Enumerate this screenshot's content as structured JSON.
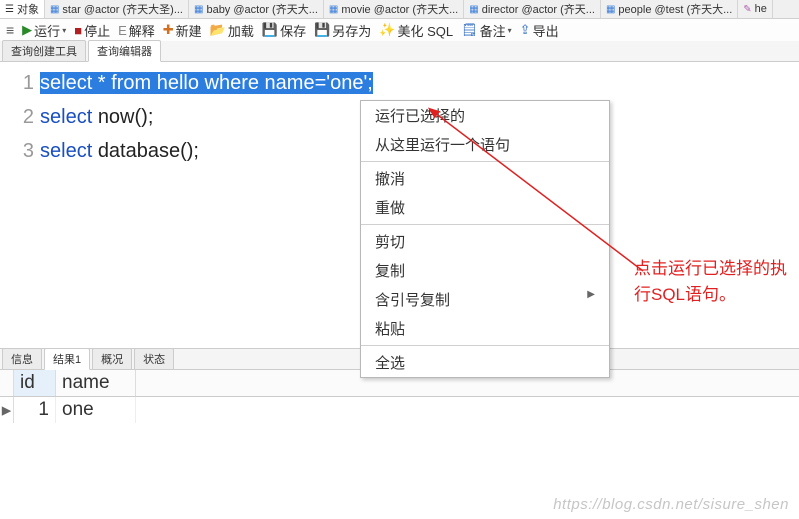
{
  "top_tabs": {
    "t0": "对象",
    "t1": "star @actor (齐天大圣)...",
    "t2": "baby @actor (齐天大...",
    "t3": "movie @actor (齐天大...",
    "t4": "director @actor (齐天...",
    "t5": "people @test (齐天大...",
    "t6": "he"
  },
  "toolbar": {
    "run": "运行",
    "stop": "停止",
    "explain": "解释",
    "create": "新建",
    "load": "加载",
    "save": "保存",
    "save_as": "另存为",
    "beautify": "美化 SQL",
    "notes": "备注",
    "export": "导出"
  },
  "sub_tabs": {
    "builder": "查询创建工具",
    "editor": "查询编辑器"
  },
  "editor": {
    "g1": "1",
    "g2": "2",
    "g3": "3",
    "l1a": "select * from hello where name='one';",
    "l2a": "select ",
    "l2b": "now();",
    "l3a": "select ",
    "l3b": "database();"
  },
  "context_menu": {
    "run_selected": "运行已选择的",
    "run_from_here": "从这里运行一个语句",
    "undo": "撤消",
    "redo": "重做",
    "cut": "剪切",
    "copy": "复制",
    "copy_quoted": "含引号复制",
    "paste": "粘贴",
    "select_all": "全选"
  },
  "annotation": {
    "text": "点击运行已选择的执行SQL语句。"
  },
  "result_tabs": {
    "info": "信息",
    "result1": "结果1",
    "profile": "概况",
    "status": "状态"
  },
  "result": {
    "col_id": "id",
    "col_name": "name",
    "row1_id": "1",
    "row1_name": "one",
    "marker": "▸"
  },
  "watermark": "https://blog.csdn.net/sisure_shen"
}
